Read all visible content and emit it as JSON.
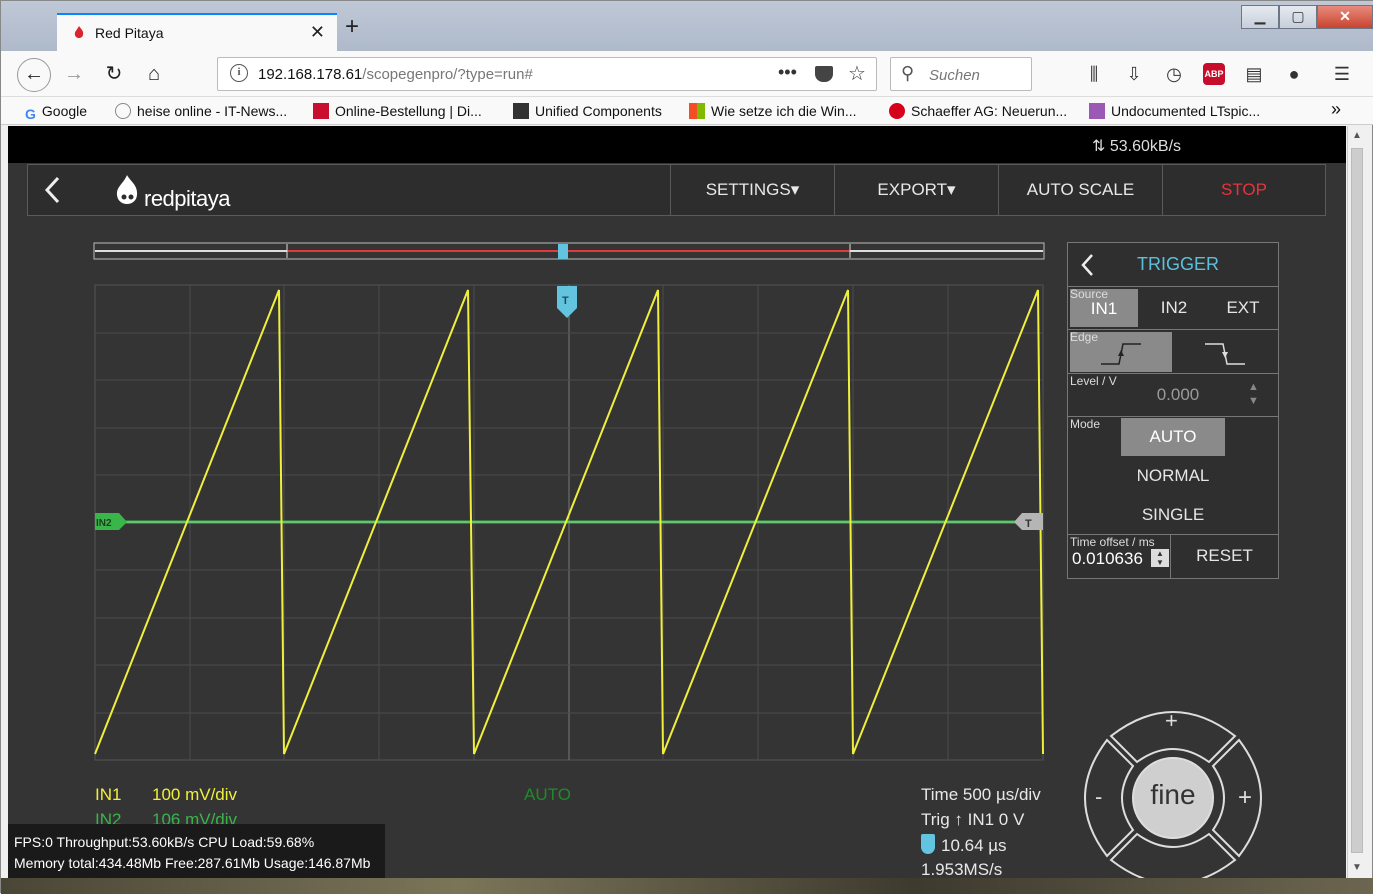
{
  "browser": {
    "tab_title": "Red Pitaya",
    "url_host": "192.168.178.61",
    "url_path": "/scopegenpro/?type=run#",
    "search_placeholder": "Suchen",
    "bookmarks": [
      "Google",
      "heise online - IT-News...",
      "Online-Bestellung | Di...",
      "Unified Components",
      "Wie setze ich die Win...",
      "Schaeffer AG: Neuerun...",
      "Undocumented LTspic..."
    ],
    "abp_label": "ABP"
  },
  "app": {
    "data_rate": "53.60kB/s",
    "logo_text": "redpitaya",
    "menu": {
      "settings": "SETTINGS",
      "export": "EXPORT",
      "auto_scale": "AUTO SCALE",
      "stop": "STOP"
    }
  },
  "scope": {
    "in2_marker": "IN2",
    "trigger_marker": "T",
    "in1_label": "IN1",
    "in1_scale": "100 mV/div",
    "in2_label": "IN2",
    "in2_scale": "106 mV/div",
    "status": "AUTO",
    "time_scale": "Time 500 µs/div",
    "trig_info": "Trig ↑ IN1 0 V",
    "trig_time": "10.64 µs",
    "sample_rate": "1.953MS/s",
    "colors": {
      "in1": "#f0ef3c",
      "in2": "#3ab54a",
      "trigger": "#62c4df",
      "background": "#343434"
    }
  },
  "trigger_panel": {
    "title": "TRIGGER",
    "source_label": "Source",
    "sources": [
      "IN1",
      "IN2",
      "EXT"
    ],
    "selected_source": "IN1",
    "edge_label": "Edge",
    "level_label": "Level / V",
    "level_value": "0.000",
    "mode_label": "Mode",
    "modes": [
      "AUTO",
      "NORMAL",
      "SINGLE"
    ],
    "selected_mode": "AUTO",
    "time_offset_label": "Time offset / ms",
    "time_offset_value": "0.010636",
    "reset_label": "RESET"
  },
  "joystick": {
    "center_label": "fine",
    "plus": "+",
    "minus": "-"
  },
  "stats": {
    "line1": "FPS:0 Throughput:53.60kB/s CPU Load:59.68%",
    "line2": "Memory total:434.48Mb Free:287.61Mb Usage:146.87Mb"
  }
}
